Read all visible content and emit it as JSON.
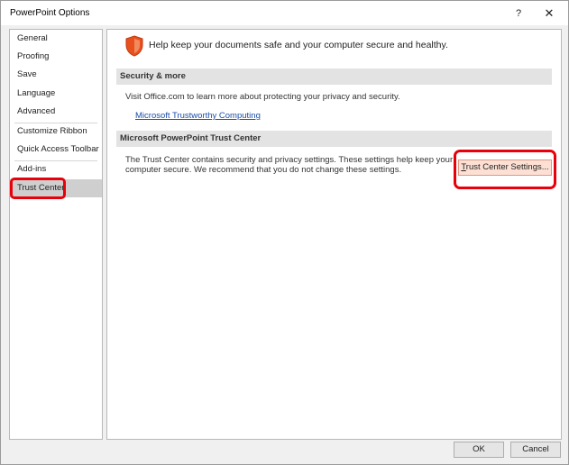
{
  "window": {
    "title": "PowerPoint Options",
    "help_label": "?",
    "close_label": "✕"
  },
  "sidebar": {
    "items": [
      {
        "label": "General"
      },
      {
        "label": "Proofing"
      },
      {
        "label": "Save"
      },
      {
        "label": "Language"
      },
      {
        "label": "Advanced"
      },
      {
        "label": "Customize Ribbon"
      },
      {
        "label": "Quick Access Toolbar"
      },
      {
        "label": "Add-ins"
      },
      {
        "label": "Trust Center"
      }
    ],
    "selected": "Trust Center"
  },
  "main": {
    "banner": {
      "icon": "shield-icon",
      "text": "Help keep your documents safe and your computer secure and healthy."
    },
    "security_section": {
      "header": "Security & more",
      "text": "Visit Office.com to learn more about protecting your privacy and security.",
      "link": "Microsoft Trustworthy Computing"
    },
    "trust_center_section": {
      "header": "Microsoft PowerPoint Trust Center",
      "text_line1": "The Trust Center contains security and privacy settings. These settings help keep your",
      "text_line2": "computer secure. We recommend that you do not change these settings.",
      "button_access_key": "T",
      "button_rest": "rust Center Settings..."
    }
  },
  "footer": {
    "ok_label": "OK",
    "cancel_label": "Cancel"
  },
  "colors": {
    "highlight": "#e8000b",
    "shield": "#e8501e",
    "link": "#1a4ea8",
    "button_hover": "#fde0d4"
  }
}
